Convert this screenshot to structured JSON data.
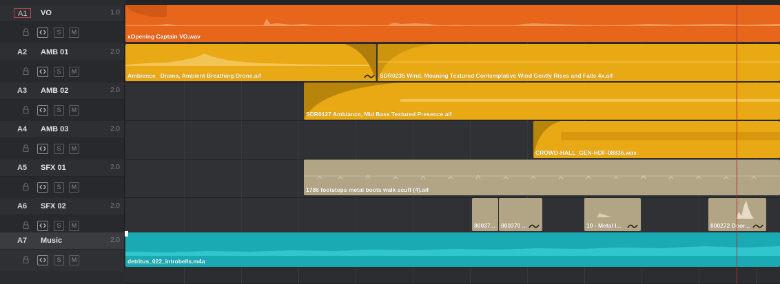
{
  "colors": {
    "vo": "#e8661c",
    "amb": "#e8a914",
    "amb_dark": "#d38f0c",
    "sfx": "#b1a586",
    "music": "#1aaab4",
    "playhead": "#b02d2d"
  },
  "tracks": [
    {
      "id": "A1",
      "name": "VO",
      "level": "1.0"
    },
    {
      "id": "A2",
      "name": "AMB 01",
      "level": "2.0"
    },
    {
      "id": "A3",
      "name": "AMB 02",
      "level": "2.0"
    },
    {
      "id": "A4",
      "name": "AMB 03",
      "level": "2.0"
    },
    {
      "id": "A5",
      "name": "SFX 01",
      "level": "2.0"
    },
    {
      "id": "A6",
      "name": "SFX 02",
      "level": "2.0"
    },
    {
      "id": "A7",
      "name": "Music",
      "level": "2.0"
    }
  ],
  "track_controls": {
    "solo": "S",
    "mute": "M"
  },
  "clips": {
    "vo": "xOpening Captain VO.wav",
    "amb01_a": "Ambience_ Drama, Ambient Breathing Drone.aif",
    "amb01_b": "SDR0235 Wind, Moaning Textured Contemplative Wind Gently Rises and Falls 4x.aif",
    "amb02": "SDR0127 Ambiance, Mid Bass Textured Presence.aif",
    "amb03": "CROWD-HALL_GEN-HDF-08836.wav",
    "sfx01": "1786 footsteps metal boots walk scuff (4).aif",
    "sfx02_a": "80037...",
    "sfx02_b": "800370 ...",
    "sfx02_c": "10 - Metal I...",
    "sfx02_d": "800272 Door...",
    "music": "detritus_022_introbells.m4a"
  }
}
